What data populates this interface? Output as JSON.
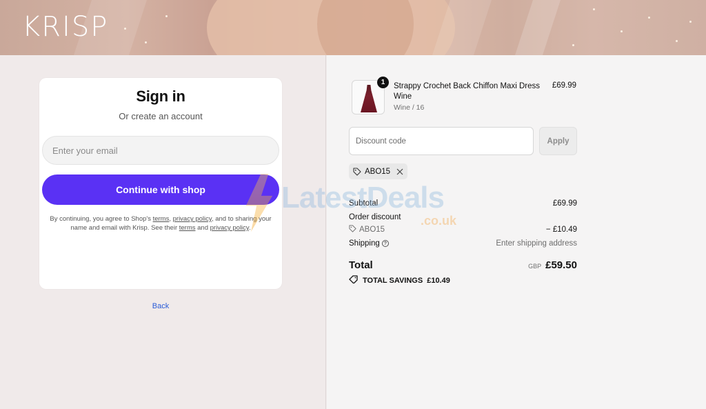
{
  "header": {
    "brand": "KRISP"
  },
  "signin": {
    "title": "Sign in",
    "subtitle": "Or create an account",
    "email_placeholder": "Enter your email",
    "continue_label": "Continue with shop",
    "legal": {
      "part1": "By continuing, you agree to Shop's ",
      "terms": "terms",
      "comma": ", ",
      "privacy": "privacy policy",
      "part2": ", and to sharing your name and email with Krisp. See their ",
      "terms2": "terms",
      "and": " and ",
      "privacy2": "privacy policy",
      "end": "."
    },
    "back_label": "Back"
  },
  "cart": {
    "item": {
      "quantity": "1",
      "name": "Strappy Crochet Back Chiffon Maxi Dress Wine",
      "variant": "Wine / 16",
      "price": "£69.99"
    },
    "discount": {
      "placeholder": "Discount code",
      "apply_label": "Apply",
      "applied_code": "ABO15"
    },
    "summary": {
      "subtotal_label": "Subtotal",
      "subtotal_value": "£69.99",
      "order_discount_label": "Order discount",
      "order_discount_code": "ABO15",
      "order_discount_value": "− £10.49",
      "shipping_label": "Shipping",
      "shipping_value": "Enter shipping address",
      "total_label": "Total",
      "currency": "GBP",
      "total_value": "£59.50",
      "savings_label": "TOTAL SAVINGS",
      "savings_value": "£10.49"
    }
  },
  "watermark": {
    "text": "LatestDeals",
    "domain": ".co.uk"
  },
  "colors": {
    "shop_purple": "#5a31f4",
    "link_blue": "#2a5bd7"
  }
}
